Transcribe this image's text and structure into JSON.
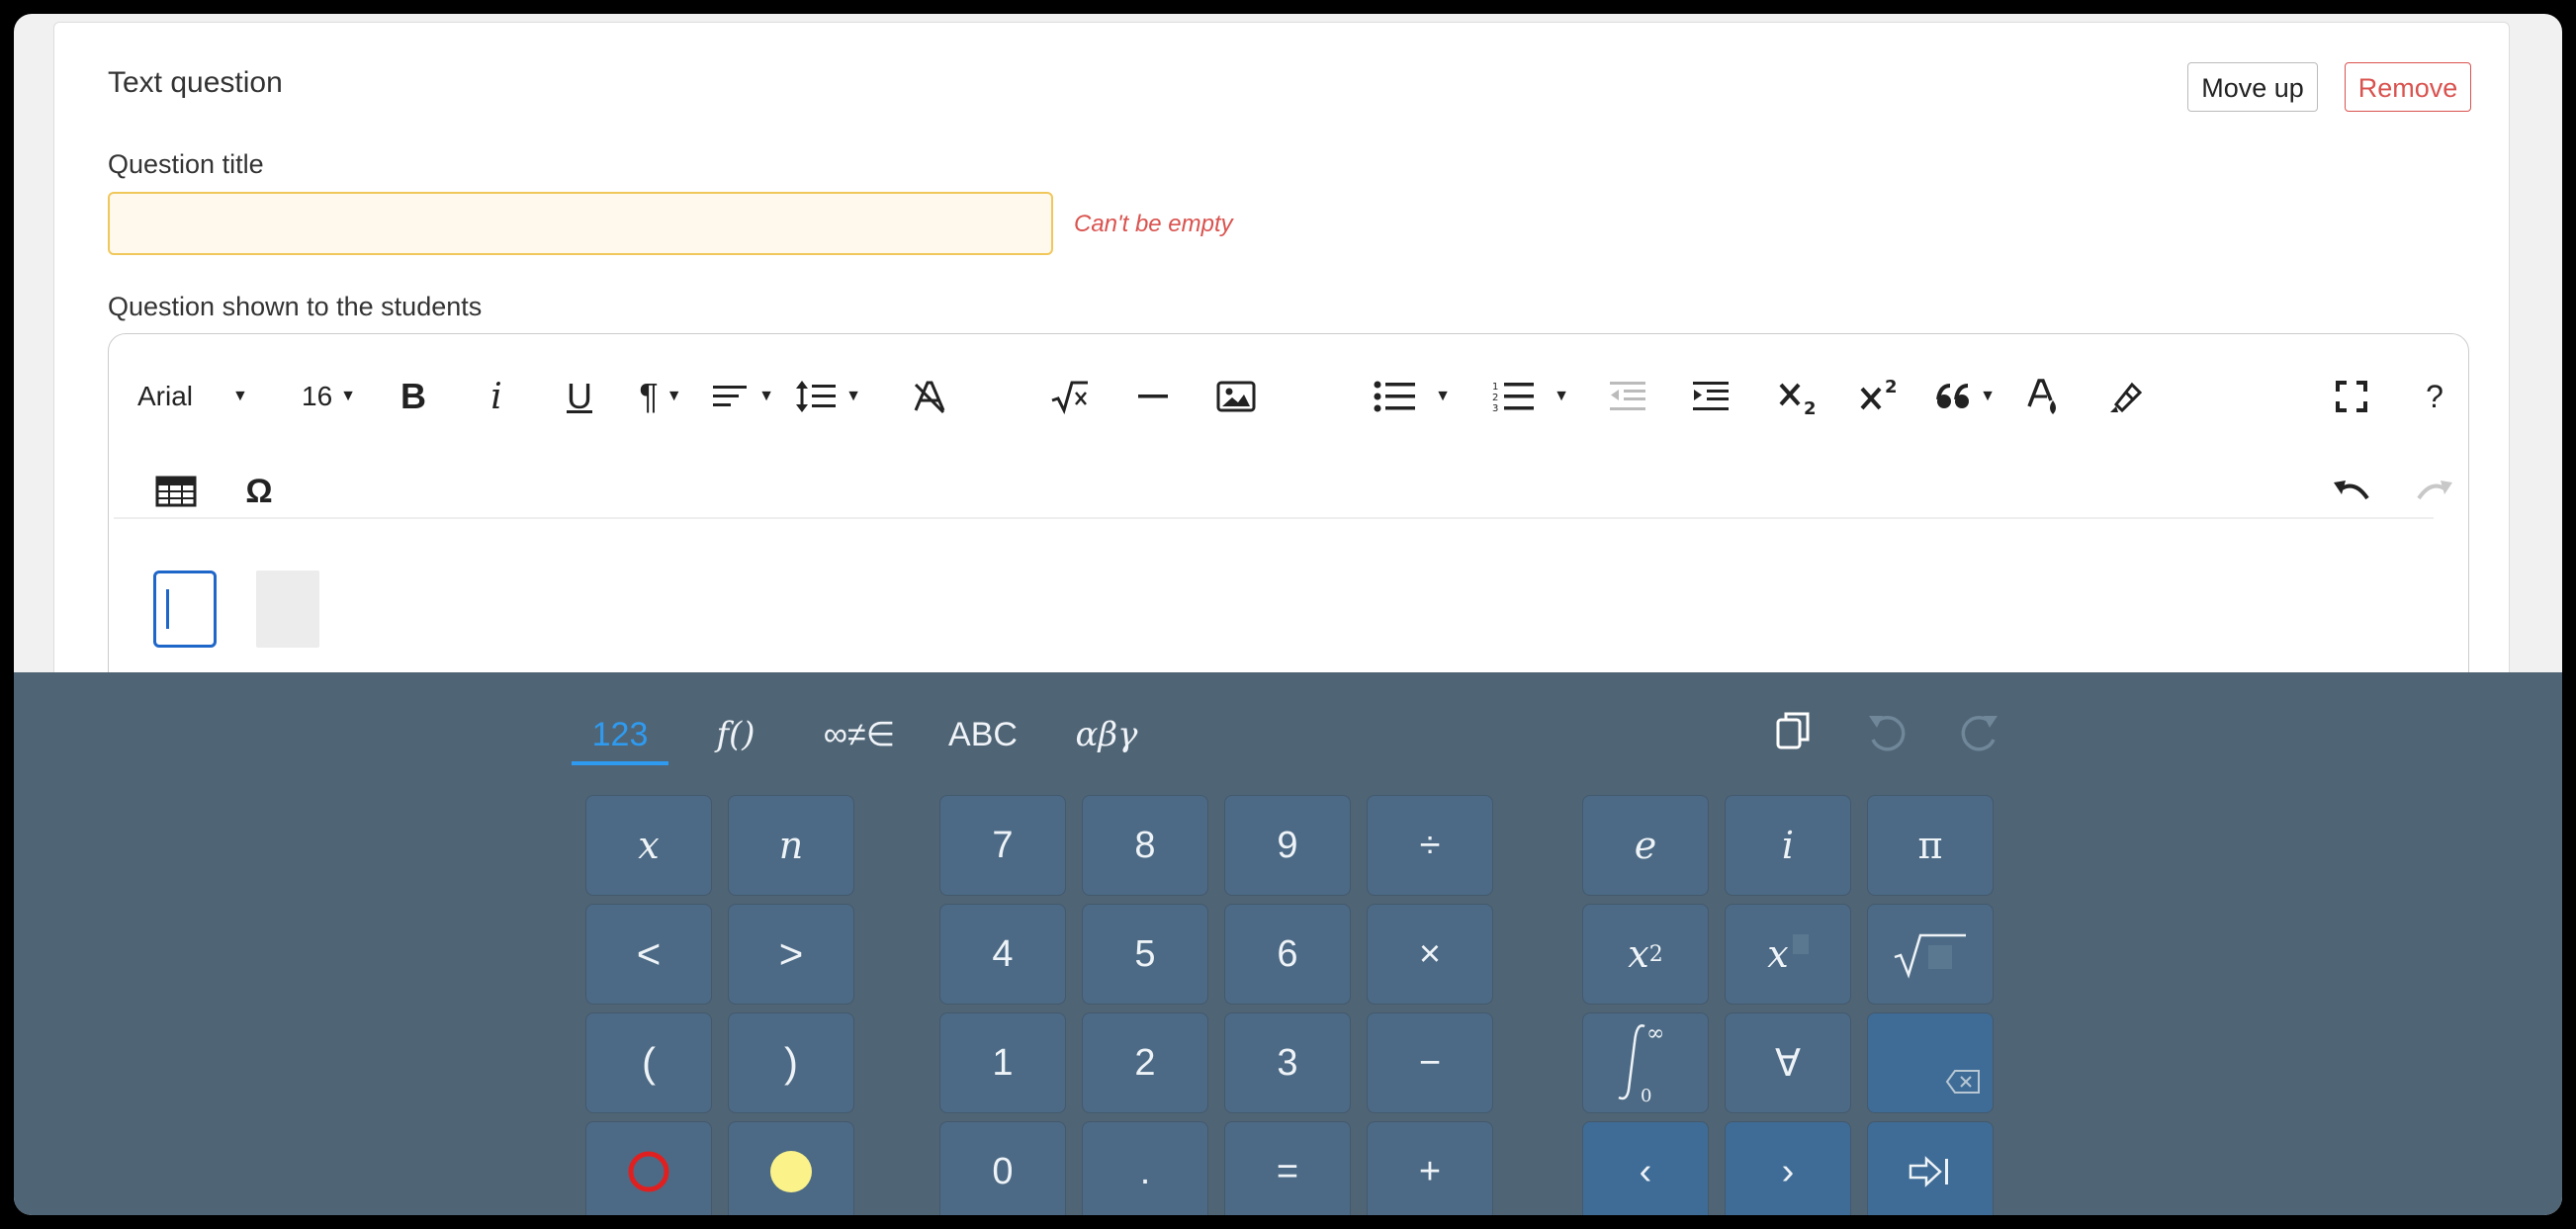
{
  "card": {
    "title": "Text question",
    "move_up_label": "Move up",
    "remove_label": "Remove"
  },
  "question_title": {
    "label": "Question title",
    "value": "",
    "error": "Can't be empty"
  },
  "question_shown": {
    "label": "Question shown to the students"
  },
  "toolbar": {
    "font_family": "Arial",
    "font_size": "16",
    "row1": [
      "bold",
      "italic",
      "underline",
      "paragraph",
      "align",
      "line-height",
      "clear-format",
      "math",
      "hr",
      "image",
      "bullet-list",
      "numbered-list",
      "outdent",
      "indent",
      "subscript",
      "superscript",
      "quote",
      "font-color",
      "highlight",
      "fullscreen",
      "help"
    ],
    "row2": [
      "table",
      "special-char",
      "undo",
      "redo"
    ],
    "bold_label": "B",
    "italic_label": "i",
    "underline_label": "U",
    "paragraph_label": "¶",
    "help_label": "?",
    "omega_label": "Ω"
  },
  "keyboard": {
    "tabs": [
      {
        "label": "123",
        "active": true
      },
      {
        "label": "f()",
        "active": false
      },
      {
        "label": "∞≠∈",
        "active": false
      },
      {
        "label": "ABC",
        "active": false
      },
      {
        "label": "αβγ",
        "active": false
      }
    ],
    "keys": {
      "x": "x",
      "n": "n",
      "lt": "<",
      "gt": ">",
      "lparen": "(",
      "rparen": ")",
      "seven": "7",
      "eight": "8",
      "nine": "9",
      "div": "÷",
      "four": "4",
      "five": "5",
      "six": "6",
      "mul": "×",
      "one": "1",
      "two": "2",
      "three": "3",
      "minus": "−",
      "zero": "0",
      "dot": ".",
      "eq": "=",
      "plus": "+",
      "e": "e",
      "i": "i",
      "pi": "π",
      "x_squared_base": "x",
      "x_squared_exp": "2",
      "x_sub_base": "x",
      "forall": "∀",
      "left": "‹",
      "right": "›"
    },
    "colors": {
      "accent": "#2f9bf0",
      "circle_red": "#e02020",
      "circle_yellow": "#fbf28a"
    }
  }
}
